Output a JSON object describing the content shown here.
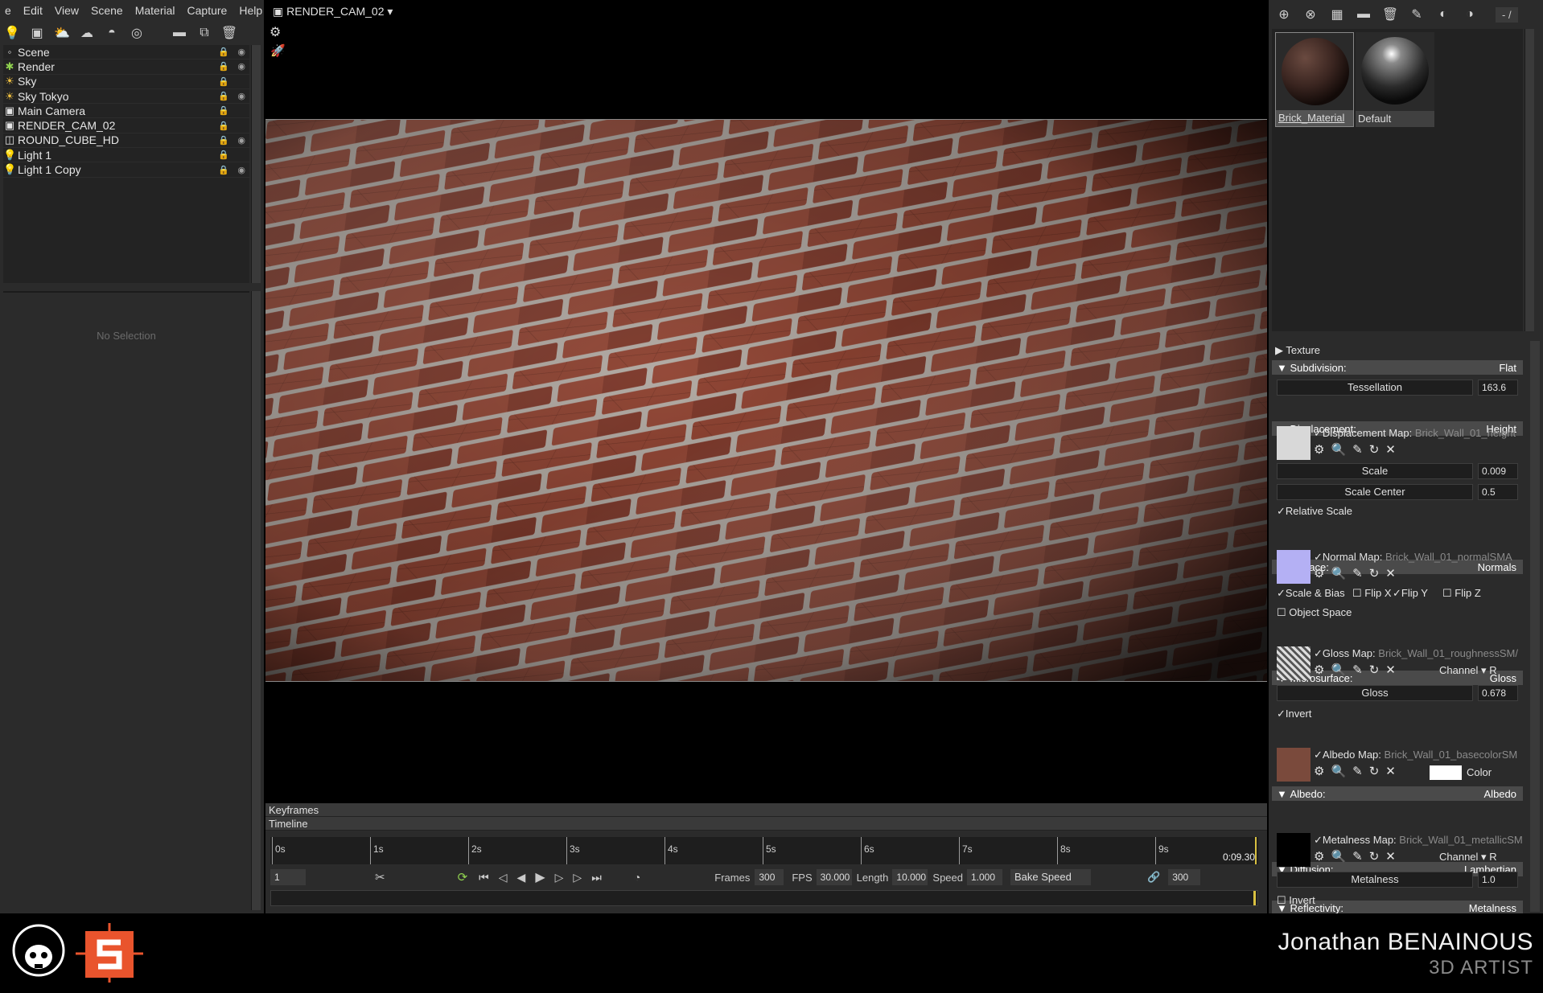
{
  "menu": [
    "e",
    "Edit",
    "View",
    "Scene",
    "Material",
    "Capture",
    "Help"
  ],
  "scene_tree": {
    "root": "Scene",
    "items": [
      {
        "label": "Render",
        "icon": "gear-icon"
      },
      {
        "label": "Sky",
        "icon": "sky-icon"
      },
      {
        "label": "Sky Tokyo",
        "icon": "sky-icon"
      },
      {
        "label": "Main Camera",
        "icon": "camera-icon"
      },
      {
        "label": "RENDER_CAM_02",
        "icon": "camera-icon"
      },
      {
        "label": "ROUND_CUBE_HD",
        "icon": "mesh-icon"
      },
      {
        "label": "Light 1",
        "icon": "light-icon"
      },
      {
        "label": "Light 1 Copy",
        "icon": "light-icon"
      }
    ]
  },
  "selection_panel": {
    "empty_text": "No Selection"
  },
  "viewport": {
    "camera": "RENDER_CAM_02"
  },
  "timeline": {
    "keyframes_label": "Keyframes",
    "timeline_label": "Timeline",
    "ticks": [
      "0s",
      "1s",
      "2s",
      "3s",
      "4s",
      "5s",
      "6s",
      "7s",
      "8s",
      "9s"
    ],
    "end_time": "0:09.30",
    "current_frame": "1",
    "frames_label": "Frames",
    "frames": "300",
    "fps_label": "FPS",
    "fps": "30.000",
    "length_label": "Length",
    "length": "10.000",
    "speed_label": "Speed",
    "speed": "1.000",
    "bake_label": "Bake Speed",
    "end_frame": "300"
  },
  "materials": {
    "slot_label": "- /",
    "items": [
      {
        "name": "Brick_Material",
        "selected": true
      },
      {
        "name": "Default",
        "selected": false
      }
    ]
  },
  "properties": {
    "texture": "Texture",
    "subdivision": {
      "label": "Subdivision:",
      "mode": "Flat",
      "tess_label": "Tessellation",
      "tess": "163.6"
    },
    "displacement": {
      "label": "Displacement:",
      "mode": "Height",
      "map_label": "Displacement Map:",
      "map": "Brick_Wall_01_height",
      "scale_label": "Scale",
      "scale": "0.009",
      "center_label": "Scale Center",
      "center": "0.5",
      "relative": "Relative Scale"
    },
    "surface": {
      "label": "Surface:",
      "mode": "Normals",
      "map_label": "Normal Map:",
      "map": "Brick_Wall_01_normalSMA",
      "scale_bias": "Scale & Bias",
      "flipx": "Flip X",
      "flipy": "Flip Y",
      "flipz": "Flip Z",
      "object_space": "Object Space"
    },
    "microsurface": {
      "label": "Microsurface:",
      "mode": "Gloss",
      "map_label": "Gloss Map:",
      "map": "Brick_Wall_01_roughnessSM/",
      "channel_label": "Channel",
      "channel": "R",
      "gloss_label": "Gloss",
      "gloss": "0.678",
      "invert": "Invert"
    },
    "albedo": {
      "label": "Albedo:",
      "mode": "Albedo",
      "map_label": "Albedo Map:",
      "map": "Brick_Wall_01_basecolorSM",
      "color_label": "Color"
    },
    "diffusion": {
      "label": "Diffusion:",
      "mode": "Lambertian"
    },
    "reflectivity": {
      "label": "Reflectivity:",
      "mode": "Metalness",
      "map_label": "Metalness Map:",
      "map": "Brick_Wall_01_metallicSM",
      "channel_label": "Channel",
      "channel": "R",
      "metal_label": "Metalness",
      "metal": "1.0",
      "invert": "Invert"
    }
  },
  "footer": {
    "author_first": "Jonathan",
    "author_last": "BENAINOUS",
    "role": "3D ARTIST"
  },
  "colors": {
    "panel": "#2b2b2b",
    "accent_green": "#8fd14f",
    "brand_orange": "#e9542d",
    "brick": "#8a4030",
    "mortar": "#a8a09a"
  }
}
